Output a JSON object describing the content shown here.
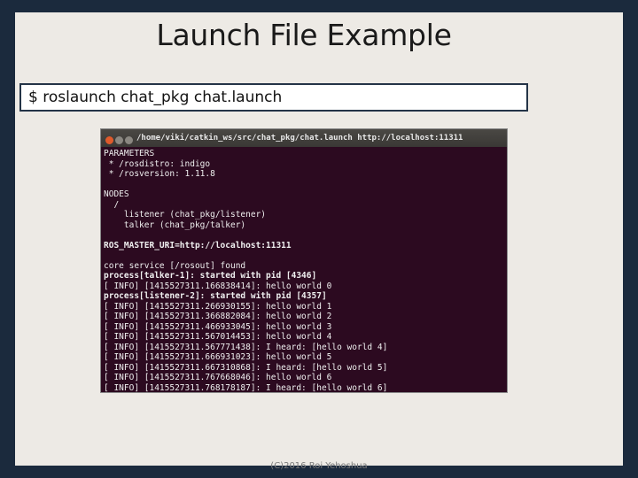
{
  "slide": {
    "title": "Launch File Example",
    "command": "$ roslaunch chat_pkg chat.launch",
    "footer": "(C)2016 Roi Yehoshua"
  },
  "terminal": {
    "title": "/home/viki/catkin_ws/src/chat_pkg/chat.launch http://localhost:11311",
    "lines": [
      {
        "text": "PARAMETERS",
        "bold": false
      },
      {
        "text": " * /rosdistro: indigo",
        "bold": false
      },
      {
        "text": " * /rosversion: 1.11.8",
        "bold": false
      },
      {
        "text": "",
        "bold": false
      },
      {
        "text": "NODES",
        "bold": false
      },
      {
        "text": "  /",
        "bold": false
      },
      {
        "text": "    listener (chat_pkg/listener)",
        "bold": false
      },
      {
        "text": "    talker (chat_pkg/talker)",
        "bold": false
      },
      {
        "text": "",
        "bold": false
      },
      {
        "text": "ROS_MASTER_URI=http://localhost:11311",
        "bold": true
      },
      {
        "text": "",
        "bold": false
      },
      {
        "text": "core service [/rosout] found",
        "bold": false
      },
      {
        "text": "process[talker-1]: started with pid [4346]",
        "bold": true
      },
      {
        "text": "[ INFO] [1415527311.166838414]: hello world 0",
        "bold": false
      },
      {
        "text": "process[listener-2]: started with pid [4357]",
        "bold": true
      },
      {
        "text": "[ INFO] [1415527311.266930155]: hello world 1",
        "bold": false
      },
      {
        "text": "[ INFO] [1415527311.366882084]: hello world 2",
        "bold": false
      },
      {
        "text": "[ INFO] [1415527311.466933045]: hello world 3",
        "bold": false
      },
      {
        "text": "[ INFO] [1415527311.567014453]: hello world 4",
        "bold": false
      },
      {
        "text": "[ INFO] [1415527311.567771438]: I heard: [hello world 4]",
        "bold": false
      },
      {
        "text": "[ INFO] [1415527311.666931023]: hello world 5",
        "bold": false
      },
      {
        "text": "[ INFO] [1415527311.667310868]: I heard: [hello world 5]",
        "bold": false
      },
      {
        "text": "[ INFO] [1415527311.767668046]: hello world 6",
        "bold": false
      },
      {
        "text": "[ INFO] [1415527311.768178187]: I heard: [hello world 6]",
        "bold": false
      }
    ]
  },
  "colors": {
    "background": "#1b2a3d",
    "slide": "#edeae5",
    "terminal_bg": "#2c0a20",
    "terminal_close": "#e05a2b"
  }
}
